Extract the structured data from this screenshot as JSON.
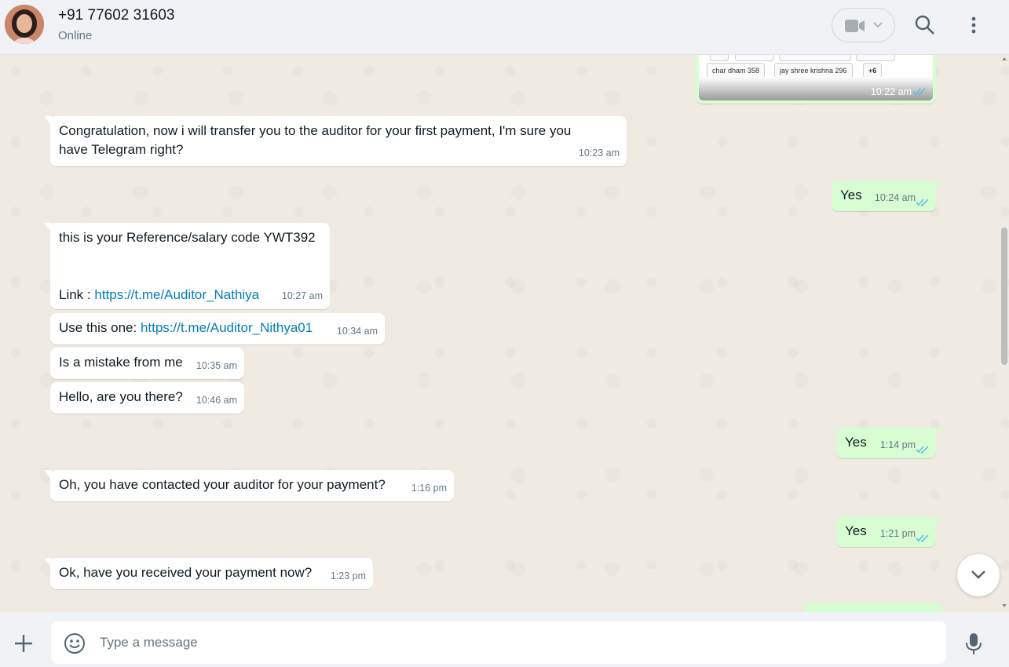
{
  "contact": {
    "name": "+91 77602 31603",
    "status": "Online"
  },
  "image_message": {
    "chips": [
      "char dham 358",
      "jay shree krishna 296",
      "+6"
    ],
    "time": "10:22 am"
  },
  "messages": [
    {
      "direction": "in",
      "text": "Congratulation, now i will transfer you to the auditor for your first payment, I'm sure you\nhave Telegram right?",
      "time": "10:23 am"
    },
    {
      "direction": "out",
      "text": "Yes",
      "time": "10:24 am",
      "read": true
    },
    {
      "direction": "in",
      "text_line1": "this is your Reference/salary code YWT392",
      "link_prefix": "Link : ",
      "link": "https://t.me/Auditor_Nathiya",
      "time": "10:27 am"
    },
    {
      "direction": "in",
      "text_prefix": "Use this one: ",
      "link": "https://t.me/Auditor_Nithya01",
      "time": "10:34 am"
    },
    {
      "direction": "in",
      "text": "Is a mistake from me",
      "time": "10:35 am"
    },
    {
      "direction": "in",
      "text": "Hello, are you there?",
      "time": "10:46 am"
    },
    {
      "direction": "out",
      "text": "Yes",
      "time": "1:14 pm",
      "read": true
    },
    {
      "direction": "in",
      "text": "Oh, you have contacted your auditor for your payment?",
      "time": "1:16 pm"
    },
    {
      "direction": "out",
      "text": "Yes",
      "time": "1:21 pm",
      "read": true
    },
    {
      "direction": "in",
      "text": "Ok, have you received your payment now?",
      "time": "1:23 pm"
    }
  ],
  "composer": {
    "placeholder": "Type a message"
  },
  "icons": {
    "avatar": "profile-photo",
    "video": "video-camera-icon",
    "dropdown": "chevron-down-icon",
    "search": "search-icon",
    "menu": "more-vertical-icon",
    "attach": "plus-icon",
    "emoji": "emoji-icon",
    "mic": "microphone-icon",
    "read_receipt": "double-check-icon",
    "scroll": "chevron-down-icon"
  },
  "colors": {
    "incoming_bubble": "#ffffff",
    "outgoing_bubble": "#d9fdd3",
    "link": "#027eb5",
    "read_tick": "#53bdeb",
    "header_bg": "#f0f2f5",
    "chat_bg": "#efeae2"
  }
}
